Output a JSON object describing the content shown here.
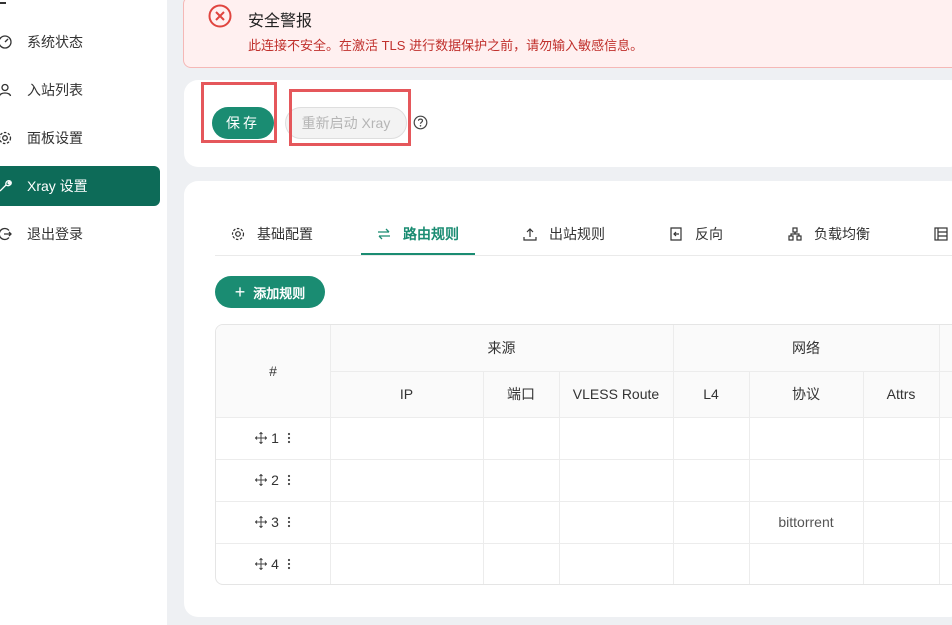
{
  "sidebar": {
    "items": [
      {
        "label": "系统状态",
        "icon": "dashboard-icon"
      },
      {
        "label": "入站列表",
        "icon": "user-icon"
      },
      {
        "label": "面板设置",
        "icon": "gear-icon"
      },
      {
        "label": "Xray 设置",
        "icon": "tool-icon",
        "active": true
      },
      {
        "label": "退出登录",
        "icon": "logout-icon"
      }
    ]
  },
  "alert": {
    "title": "安全警报",
    "description": "此连接不安全。在激活 TLS 进行数据保护之前，请勿输入敏感信息。"
  },
  "toolbar": {
    "save_label": "保存",
    "restart_label": "重新启动 Xray"
  },
  "tabs": [
    {
      "label": "基础配置",
      "icon": "gear-icon"
    },
    {
      "label": "路由规则",
      "icon": "swap-icon",
      "active": true
    },
    {
      "label": "出站规则",
      "icon": "upload-icon"
    },
    {
      "label": "反向",
      "icon": "reverse-icon"
    },
    {
      "label": "负载均衡",
      "icon": "cluster-icon"
    }
  ],
  "add_rule_label": "添加规则",
  "table": {
    "index_header": "#",
    "groups": [
      "来源",
      "网络"
    ],
    "columns": [
      "IP",
      "端口",
      "VLESS Route",
      "L4",
      "协议",
      "Attrs"
    ],
    "rows": [
      {
        "index": "1",
        "protocol": ""
      },
      {
        "index": "2",
        "protocol": ""
      },
      {
        "index": "3",
        "protocol": "bittorrent"
      },
      {
        "index": "4",
        "protocol": ""
      }
    ]
  },
  "colors": {
    "primary": "#1a8c72",
    "sidebar_active": "#0d6b58",
    "alert_bg": "#fff0f0",
    "alert_text": "#c0302c",
    "highlight": "#e5575b"
  }
}
